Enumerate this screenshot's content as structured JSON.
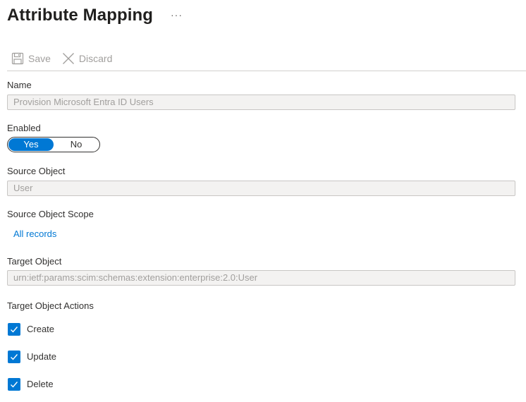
{
  "header": {
    "title": "Attribute Mapping",
    "more_label": "···"
  },
  "toolbar": {
    "save_label": "Save",
    "discard_label": "Discard"
  },
  "fields": {
    "name": {
      "label": "Name",
      "value": "Provision Microsoft Entra ID Users"
    },
    "enabled": {
      "label": "Enabled",
      "options": [
        "Yes",
        "No"
      ],
      "selected": "Yes"
    },
    "source_object": {
      "label": "Source Object",
      "value": "User"
    },
    "source_object_scope": {
      "label": "Source Object Scope",
      "link": "All records"
    },
    "target_object": {
      "label": "Target Object",
      "value": "urn:ietf:params:scim:schemas:extension:enterprise:2.0:User"
    },
    "target_object_actions": {
      "label": "Target Object Actions",
      "items": [
        {
          "label": "Create",
          "checked": true
        },
        {
          "label": "Update",
          "checked": true
        },
        {
          "label": "Delete",
          "checked": true
        }
      ]
    }
  },
  "colors": {
    "accent": "#0078d4",
    "disabled_text": "#a19f9d",
    "input_bg": "#f3f2f1"
  },
  "icons": {
    "save": "save-icon",
    "discard": "close-icon",
    "check": "checkmark-icon"
  }
}
